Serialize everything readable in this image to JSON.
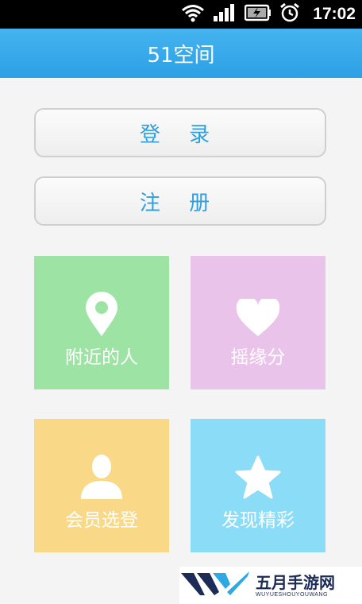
{
  "status_bar": {
    "time": "17:02"
  },
  "app": {
    "title": "51空间"
  },
  "buttons": {
    "login": "登 录",
    "register": "注 册"
  },
  "tiles": [
    {
      "label": "附近的人",
      "color": "#9de3a3",
      "icon": "location-pin-icon"
    },
    {
      "label": "摇缘分",
      "color": "#e9c3ea",
      "icon": "heart-icon"
    },
    {
      "label": "会员选登",
      "color": "#f9d987",
      "icon": "user-icon"
    },
    {
      "label": "发现精彩",
      "color": "#8bdcf7",
      "icon": "star-icon"
    }
  ],
  "watermark": {
    "name": "五月手游网",
    "domain": "WUYUESHOUYOUWANG"
  }
}
